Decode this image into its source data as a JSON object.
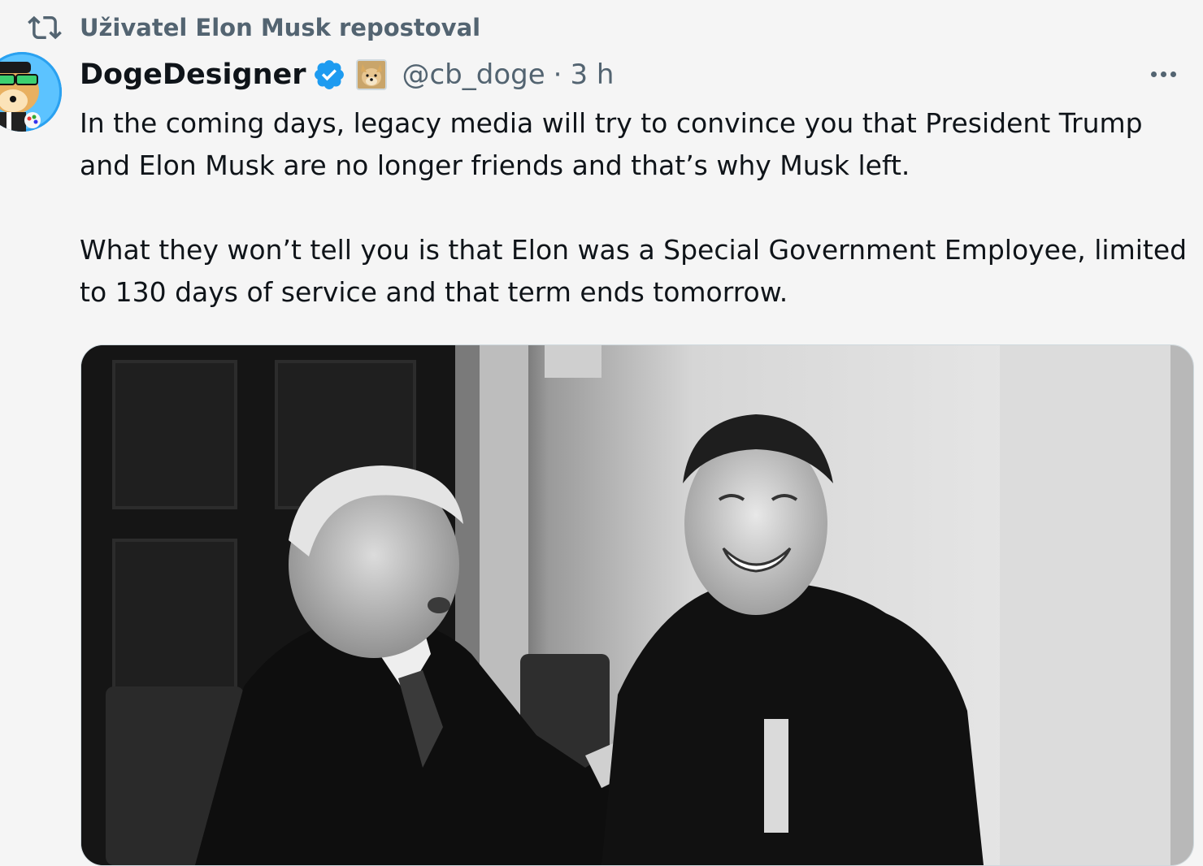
{
  "repost": {
    "label": "Uživatel Elon Musk repostoval",
    "icon": "repost-icon"
  },
  "author": {
    "display_name": "DogeDesigner",
    "handle": "@cb_doge",
    "separator": "·",
    "time": "3 h",
    "verified_icon": "verified-badge-icon",
    "affiliate_icon": "doge-affiliate-icon"
  },
  "tweet": {
    "paragraphs": [
      "In the coming days, legacy media will try to convince you that President Trump and Elon Musk are no longer friends and that’s why Musk left.",
      "What they won’t tell you is that Elon was a Special Government Employee, limited to 130 days of service and that term ends tomorrow."
    ]
  },
  "media": {
    "type": "photo",
    "style": "black-and-white"
  },
  "colors": {
    "text": "#0f1419",
    "secondary": "#536471",
    "verified": "#1d9bf0",
    "background": "#f5f5f5"
  }
}
